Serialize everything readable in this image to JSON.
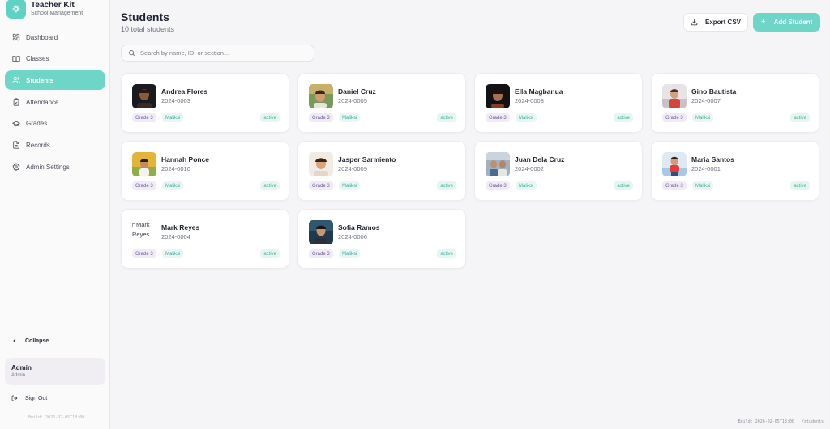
{
  "app": {
    "title": "Teacher Kit",
    "subtitle": "School Management"
  },
  "sidebar": {
    "items": [
      {
        "label": "Dashboard",
        "icon": "dashboard-icon"
      },
      {
        "label": "Classes",
        "icon": "book-icon"
      },
      {
        "label": "Students",
        "icon": "users-icon",
        "active": true
      },
      {
        "label": "Attendance",
        "icon": "clipboard-check-icon"
      },
      {
        "label": "Grades",
        "icon": "graduation-cap-icon"
      },
      {
        "label": "Records",
        "icon": "file-text-icon"
      },
      {
        "label": "Admin Settings",
        "icon": "gear-icon"
      }
    ],
    "collapse_label": "Collapse",
    "user": {
      "name": "Admin",
      "role": "Admin"
    },
    "signout_label": "Sign Out",
    "build": "Build: 2026-02-05T18:00"
  },
  "header": {
    "title": "Students",
    "subtitle": "10 total students",
    "export_label": "Export CSV",
    "add_label": "Add Student"
  },
  "search": {
    "placeholder": "Search by name, ID, or section..."
  },
  "students": [
    {
      "name": "Andrea Flores",
      "id": "2024-0003",
      "grade": "Grade 3",
      "section": "Maliksi",
      "status": "active"
    },
    {
      "name": "Daniel Cruz",
      "id": "2024-0005",
      "grade": "Grade 3",
      "section": "Maliksi",
      "status": "active"
    },
    {
      "name": "Ella Magbanua",
      "id": "2024-0008",
      "grade": "Grade 3",
      "section": "Maliksi",
      "status": "active"
    },
    {
      "name": "Gino Bautista",
      "id": "2024-0007",
      "grade": "Grade 3",
      "section": "Maliksi",
      "status": "active"
    },
    {
      "name": "Hannah Ponce",
      "id": "2024-0010",
      "grade": "Grade 3",
      "section": "Maliksi",
      "status": "active"
    },
    {
      "name": "Jasper Sarmiento",
      "id": "2024-0009",
      "grade": "Grade 3",
      "section": "Maliksi",
      "status": "active"
    },
    {
      "name": "Juan Dela Cruz",
      "id": "2024-0002",
      "grade": "Grade 3",
      "section": "Maliksi",
      "status": "active"
    },
    {
      "name": "Maria Santos",
      "id": "2024-0001",
      "grade": "Grade 3",
      "section": "Maliksi",
      "status": "active"
    },
    {
      "name": "Mark Reyes",
      "id": "2024-0004",
      "grade": "Grade 3",
      "section": "Maliksi",
      "status": "active",
      "avatar_alt": "Mark Reyes"
    },
    {
      "name": "Sofia Ramos",
      "id": "2024-0006",
      "grade": "Grade 3",
      "section": "Maliksi",
      "status": "active"
    }
  ],
  "footer": {
    "build": "Build: 2026-02-05T18:00 | /students"
  },
  "colors": {
    "accent": "#6dd6c7",
    "background": "#f5f5f7",
    "card": "#ffffff"
  }
}
